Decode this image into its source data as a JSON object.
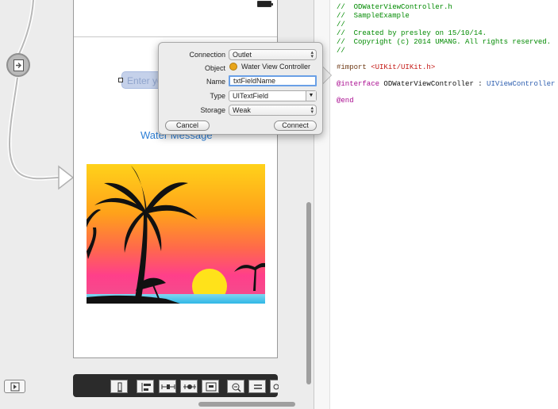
{
  "scene": {
    "textfield_placeholder": "Enter your name",
    "label_text": "Water Message"
  },
  "popover": {
    "connection_label": "Connection",
    "connection_value": "Outlet",
    "object_label": "Object",
    "object_value": "Water View Controller",
    "name_label": "Name",
    "name_value": "txtFieldName",
    "type_label": "Type",
    "type_value": "UITextField",
    "storage_label": "Storage",
    "storage_value": "Weak",
    "cancel_label": "Cancel",
    "connect_label": "Connect"
  },
  "editor": {
    "lines": [
      {
        "cls": "c-comment",
        "text": "//"
      },
      {
        "cls": "c-comment",
        "text": "//  ODWaterViewController.h"
      },
      {
        "cls": "c-comment",
        "text": "//  SampleExample"
      },
      {
        "cls": "c-comment",
        "text": "//"
      },
      {
        "cls": "c-comment",
        "text": "//  Created by presley on 15/10/14."
      },
      {
        "cls": "c-comment",
        "text": "//  Copyright (c) 2014 UMANG. All rights reserved."
      },
      {
        "cls": "c-comment",
        "text": "//"
      }
    ],
    "import_directive": "#import",
    "import_path": "<UIKit/UIKit.h>",
    "interface_keyword": "@interface",
    "class_name": "ODWaterViewController",
    "colon": " : ",
    "superclass": "UIViewController",
    "end_keyword": "@end"
  },
  "colors": {
    "accent_blue": "#2d7fd6",
    "comment_green": "#008a00",
    "keyword_purple": "#aa0d91"
  },
  "icons": [
    "segue-scene-icon",
    "battery-icon",
    "palm-tree-image",
    "resolve-issues-icon",
    "zoom-out-icon",
    "zoom-reset-icon",
    "zoom-in-icon"
  ]
}
